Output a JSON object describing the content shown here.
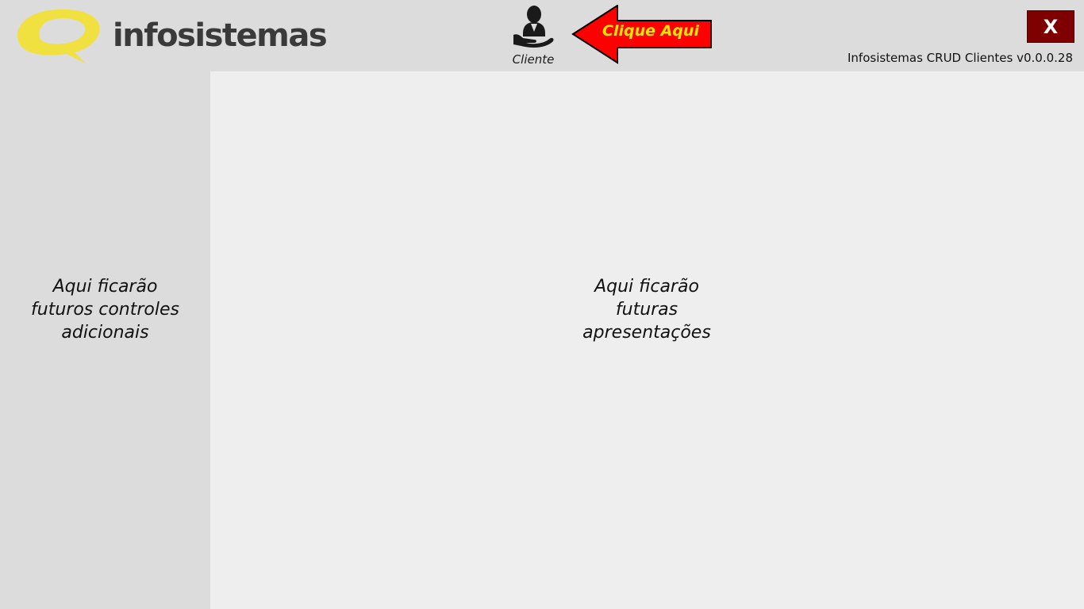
{
  "header": {
    "brand": "infosistemas",
    "client_button": {
      "label": "Cliente",
      "icon": "client-hand-icon"
    },
    "callout": {
      "label": "Clique Aqui",
      "fill_color": "#ff0000",
      "text_color": "#ffe600"
    },
    "close_button": {
      "label": "X",
      "color": "#7f0000"
    },
    "version": "Infosistemas CRUD Clientes v0.0.0.28"
  },
  "sidebar": {
    "placeholder": "Aqui ficarão\nfuturos controles\nadicionais"
  },
  "main": {
    "placeholder": "Aqui ficarão\nfuturas\napresentações"
  },
  "colors": {
    "header_bg": "#dcdcdc",
    "main_bg": "#eeeeee",
    "logo_accent": "#f0e040"
  }
}
